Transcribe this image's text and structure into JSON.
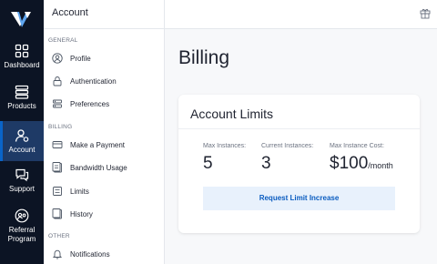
{
  "rail": {
    "items": [
      {
        "label": "Dashboard",
        "icon": "dashboard-icon"
      },
      {
        "label": "Products",
        "icon": "products-icon"
      },
      {
        "label": "Account",
        "icon": "account-icon",
        "active": true
      },
      {
        "label": "Support",
        "icon": "support-icon"
      },
      {
        "label": "Referral Program",
        "line1": "Referral",
        "line2": "Program",
        "icon": "referral-icon"
      }
    ]
  },
  "subnav": {
    "title": "Account",
    "sections": {
      "general": "GENERAL",
      "billing": "BILLING",
      "other": "OTHER"
    },
    "items": [
      {
        "label": "Profile",
        "icon": "profile-icon"
      },
      {
        "label": "Authentication",
        "icon": "lock-icon"
      },
      {
        "label": "Preferences",
        "icon": "preferences-icon"
      },
      {
        "label": "Make a Payment",
        "icon": "credit-card-icon"
      },
      {
        "label": "Bandwidth Usage",
        "icon": "bandwidth-icon"
      },
      {
        "label": "Limits",
        "icon": "limits-icon"
      },
      {
        "label": "History",
        "icon": "history-icon"
      },
      {
        "label": "Notifications",
        "icon": "bell-icon"
      }
    ]
  },
  "main": {
    "title": "Billing",
    "card": {
      "title": "Account Limits",
      "stats": [
        {
          "label": "Max Instances:",
          "value": "5"
        },
        {
          "label": "Current Instances:",
          "value": "3"
        },
        {
          "label": "Max Instance Cost:",
          "value": "$100",
          "unit": "/month"
        }
      ],
      "button_label": "Request Limit Increase"
    }
  },
  "colors": {
    "rail_bg": "#0c1424",
    "rail_active": "#1e3a66",
    "accent": "#0a64c8",
    "button_bg": "#e8f1fc"
  }
}
